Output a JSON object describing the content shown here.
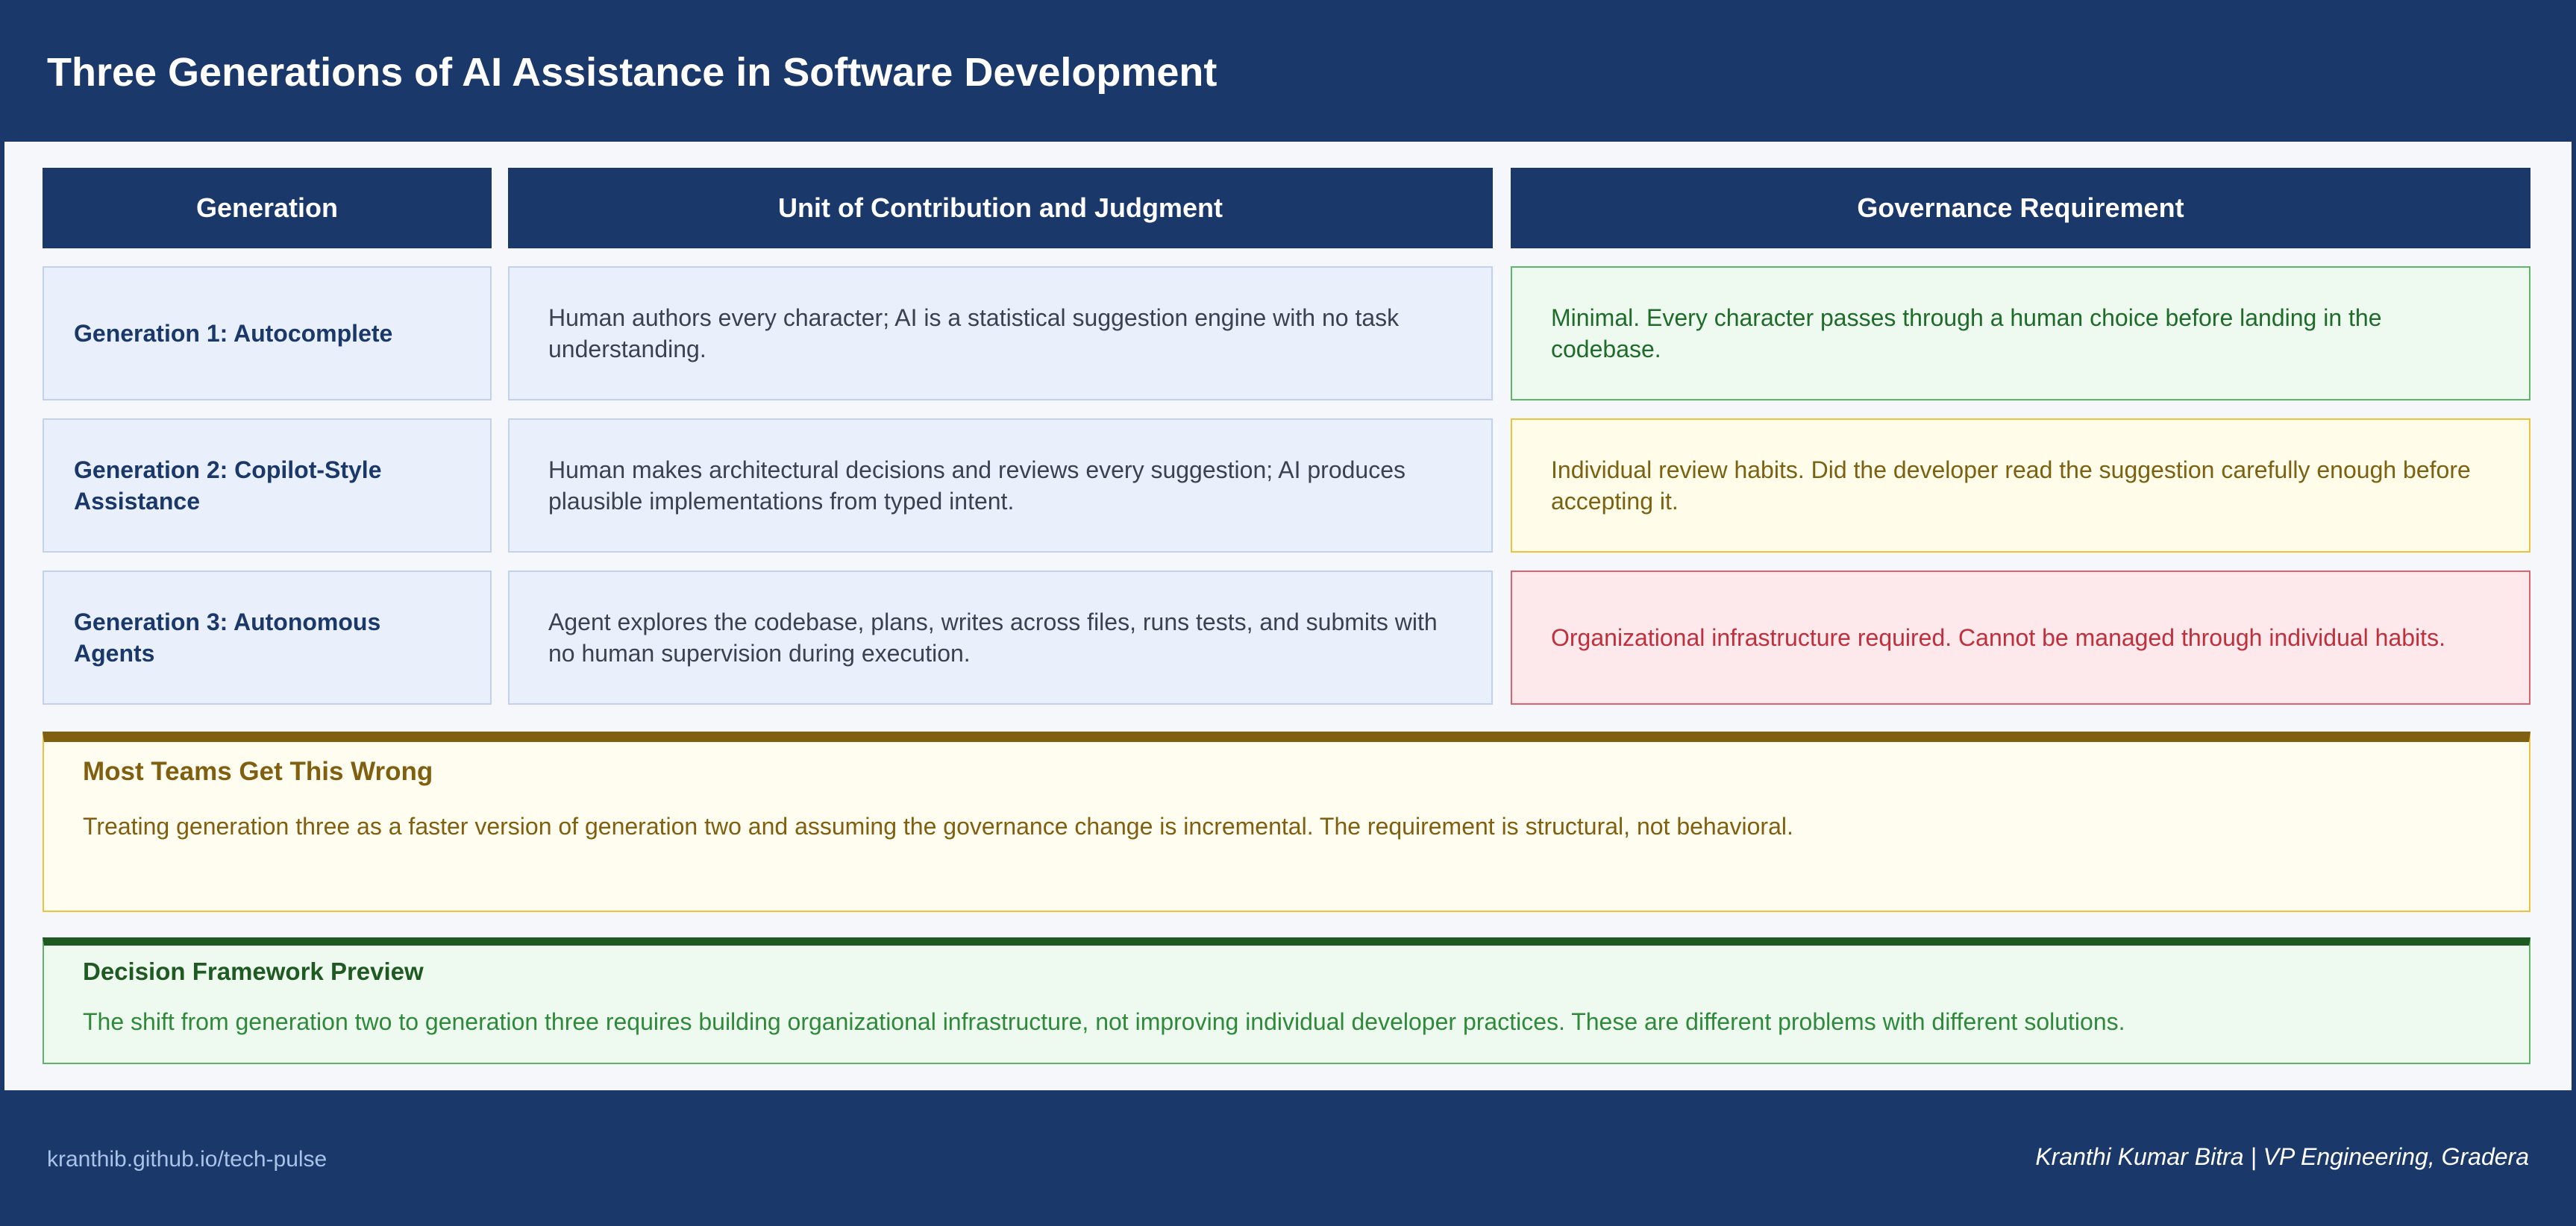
{
  "title": "Three Generations of AI Assistance in Software Development",
  "columns": [
    "Generation",
    "Unit of Contribution and Judgment",
    "Governance Requirement"
  ],
  "rows": [
    {
      "generation": "Generation 1: Autocomplete",
      "unit": "Human authors every character; AI is a statistical suggestion engine with no task understanding.",
      "governance": "Minimal. Every character passes through a human choice before landing in the codebase.",
      "governance_level": "green"
    },
    {
      "generation": "Generation 2: Copilot-Style Assistance",
      "unit": "Human makes architectural decisions and reviews every suggestion; AI produces plausible implementations from typed intent.",
      "governance": "Individual review habits. Did the developer read the suggestion carefully enough before accepting it.",
      "governance_level": "yellow"
    },
    {
      "generation": "Generation 3: Autonomous Agents",
      "unit": "Agent explores the codebase, plans, writes across files, runs tests, and submits with no human supervision during execution.",
      "governance": "Organizational infrastructure required. Cannot be managed through individual habits.",
      "governance_level": "red"
    }
  ],
  "warning": {
    "title": "Most Teams Get This Wrong",
    "text": "Treating generation three as a faster version of generation two and assuming the governance change is incremental. The requirement is structural, not behavioral."
  },
  "preview": {
    "title": "Decision Framework Preview",
    "text": "The shift from generation two to generation three requires building organizational infrastructure, not improving individual developer practices. These are different problems with different solutions."
  },
  "footer": {
    "url": "kranthib.github.io/tech-pulse",
    "author": "Kranthi Kumar Bitra | VP Engineering, Gradera"
  },
  "colors": {
    "navy": "#1b386b",
    "green": "#1e6b2a",
    "yellow": "#806010",
    "red": "#c0303c"
  }
}
